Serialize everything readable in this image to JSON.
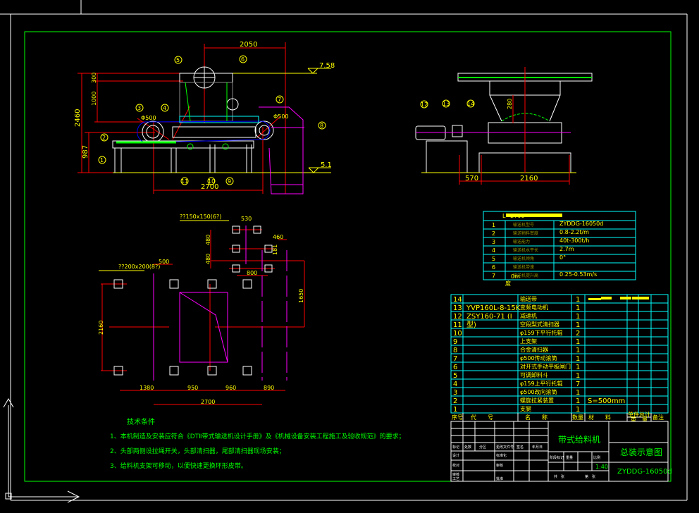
{
  "colors": {
    "background": "#000000",
    "frame": "#ffffff",
    "border": "#00ff00",
    "table_lines": "#00ffff",
    "text": "#ffff00",
    "dimension": "#ff0000",
    "chute": "#ff00ff"
  },
  "front_view": {
    "dims": {
      "top_width": "2050",
      "total_height": "2460",
      "belt_height": "987",
      "length": "2700",
      "upper": "300",
      "mid": "1000"
    },
    "levels": {
      "top": "7.58",
      "ground": "5.1"
    },
    "pulley_labels": {
      "head": "Φ500",
      "tail": "Φ500"
    },
    "callouts": [
      "5",
      "6",
      "3",
      "4",
      "7",
      "8",
      "2",
      "1",
      "11",
      "10",
      "9"
    ]
  },
  "side_view": {
    "dims": {
      "left": "570",
      "width": "2160",
      "height": "280"
    },
    "callouts": [
      "12",
      "13",
      "14"
    ]
  },
  "plan_view": {
    "labels": {
      "anchor_small": "??150x150(6?)",
      "anchor_large": "??200x200(8?)"
    },
    "dims": {
      "d530": "530",
      "d460": "460",
      "d480a": "480",
      "d480b": "480",
      "d181": "181",
      "d800": "800",
      "d1650": "1650",
      "d500": "500",
      "d2160": "2160",
      "d1380": "1380",
      "d950": "950",
      "d960": "960",
      "d890": "890",
      "d2700": "2700"
    }
  },
  "params_table": {
    "header": "L=2700",
    "rows": [
      {
        "no": "1",
        "name": "输送机型号",
        "value": "ZYDDG-16050d"
      },
      {
        "no": "2",
        "name": "输送物料密度",
        "value": "0.8-2.2t/m"
      },
      {
        "no": "3",
        "name": "输送能力",
        "value": "40t-300t/h"
      },
      {
        "no": "4",
        "name": "输送机水平长",
        "value": "2.7m"
      },
      {
        "no": "5",
        "name": "输送机倾角",
        "value": "0°"
      },
      {
        "no": "6",
        "name": "输送机带速",
        "value": ""
      },
      {
        "no": "7",
        "name": "输送机提升高",
        "value": "0.25-0.53m/s"
      }
    ],
    "extra_value": "0m",
    "unit_mark": "度"
  },
  "parts_list": {
    "rows": [
      {
        "no": "14",
        "code": "",
        "name": "输送带",
        "qty": "1",
        "material": ""
      },
      {
        "no": "13",
        "code": "YVP160L-8-15K",
        "name": "变频电动机",
        "qty": "1",
        "material": ""
      },
      {
        "no": "12",
        "code": "ZSY160-71 (I",
        "name": "减速机",
        "qty": "1",
        "material": ""
      },
      {
        "no": "11",
        "code": "型)",
        "name": "空段梨式清扫器",
        "qty": "1",
        "material": ""
      },
      {
        "no": "10",
        "code": "",
        "name": "φ159下平行托辊",
        "qty": "2",
        "material": ""
      },
      {
        "no": "9",
        "code": "",
        "name": "上支架",
        "qty": "1",
        "material": ""
      },
      {
        "no": "8",
        "code": "",
        "name": "合金清扫器",
        "qty": "1",
        "material": ""
      },
      {
        "no": "7",
        "code": "",
        "name": "φ500传动滚筒",
        "qty": "1",
        "material": ""
      },
      {
        "no": "6",
        "code": "",
        "name": "对开式手动平板闸门",
        "qty": "1",
        "material": ""
      },
      {
        "no": "5",
        "code": "",
        "name": "可调卸料斗",
        "qty": "1",
        "material": ""
      },
      {
        "no": "4",
        "code": "",
        "name": "φ159上平行托辊",
        "qty": "7",
        "material": ""
      },
      {
        "no": "3",
        "code": "",
        "name": "φ500改向滚筒",
        "qty": "1",
        "material": ""
      },
      {
        "no": "2",
        "code": "",
        "name": "螺旋拉紧装置",
        "qty": "1",
        "material": "S=500mm"
      },
      {
        "no": "1",
        "code": "",
        "name": "支腿",
        "qty": "1",
        "material": ""
      }
    ],
    "header": {
      "no": "序号",
      "code": "代　　号",
      "name": "名　　称",
      "qty": "数量",
      "material": "材　　料",
      "unit": "单件",
      "total": "总计",
      "weight": "重　量",
      "remark": "备注"
    }
  },
  "title_block": {
    "product": "带式给料机",
    "drawing": "总装示意图",
    "drawing_no": "ZYDDG-16050d",
    "scale": "1:40",
    "labels": {
      "mark": "标记",
      "count": "处数",
      "zone": "分区",
      "change": "更改文件号",
      "sign": "签名",
      "date": "年月日",
      "design": "设计",
      "standard": "标准化",
      "check": "校对",
      "review": "审核",
      "review2": "审核",
      "process": "工艺",
      "approve": "批准",
      "stage": "阶段标记",
      "weight": "重量",
      "scale": "比例",
      "sheets": "共　张",
      "sheet": "第　张"
    }
  },
  "tech_notes": {
    "title": "技术条件",
    "items": [
      "1、本机制造及安装应符合《DTⅡ带式输送机设计手册》及《机械设备安装工程施工及验收规范》的要求；",
      "2、头部两侧设拉绳开关，头部清扫器，尾部清扫器现场安装；",
      "3、给料机支架可移动，以便快速更换环形皮带。"
    ]
  }
}
